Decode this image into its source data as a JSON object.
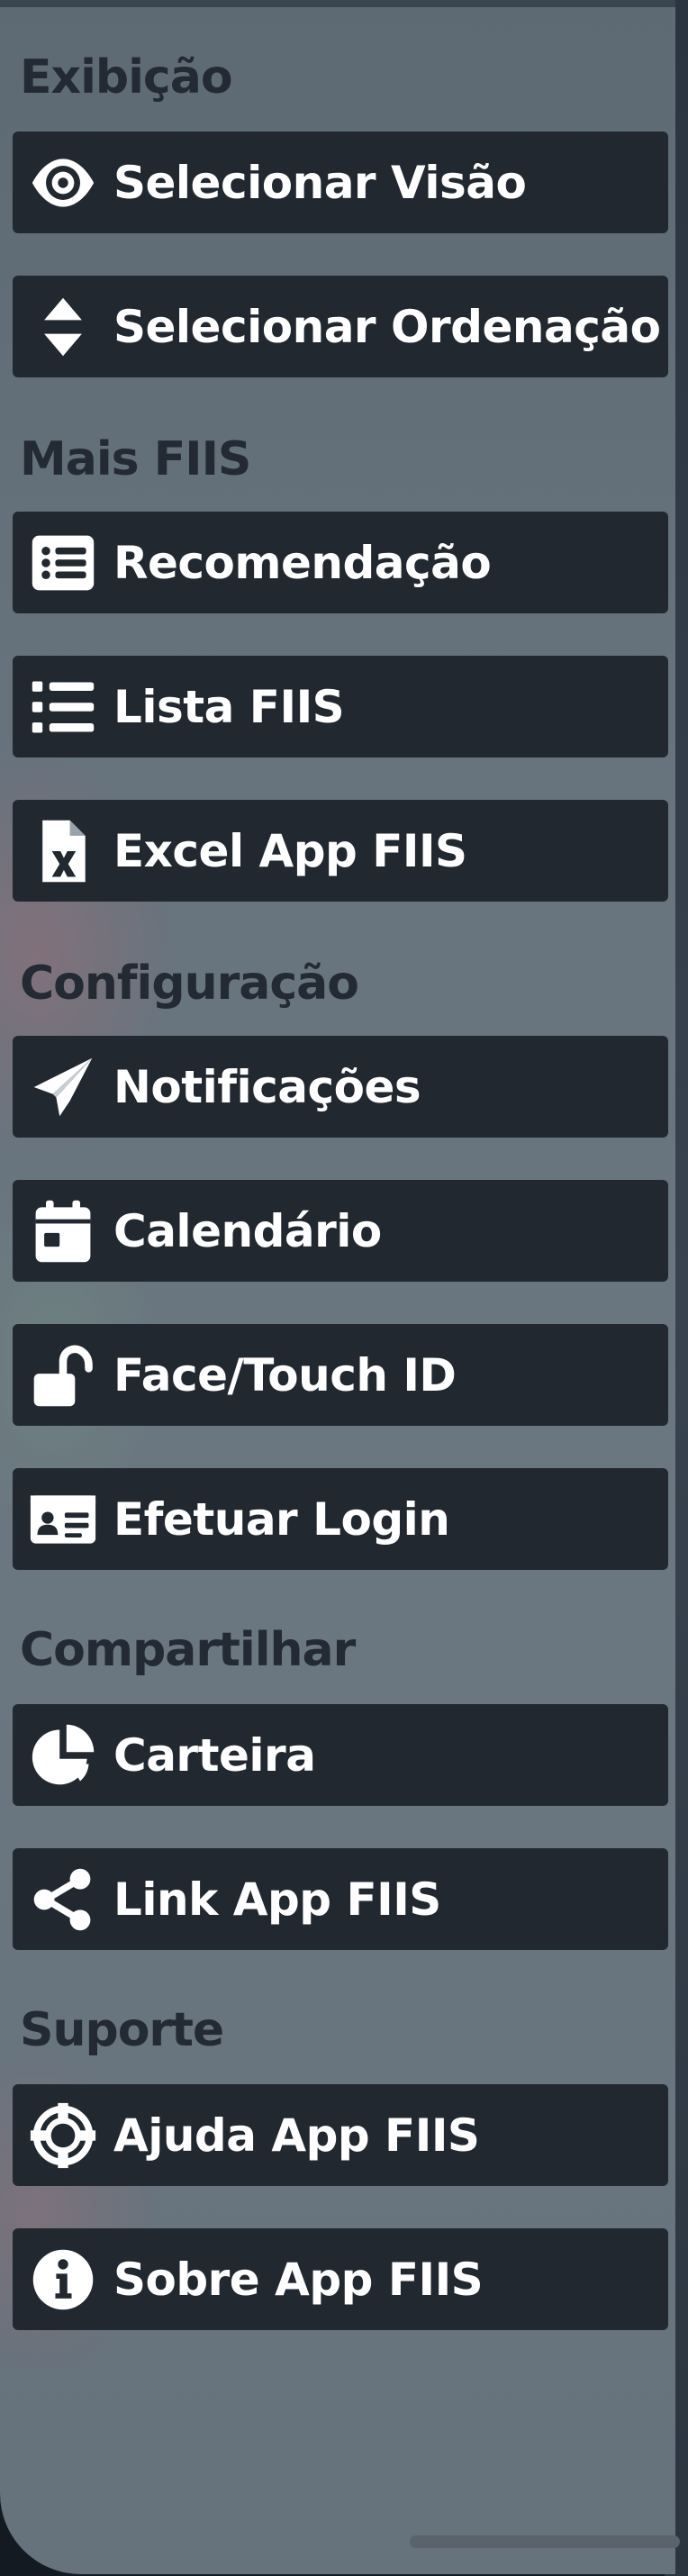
{
  "sections": [
    {
      "title": "Exibição"
    },
    {
      "title": "Mais FIIS"
    },
    {
      "title": "Configuração"
    },
    {
      "title": "Compartilhar"
    },
    {
      "title": "Suporte"
    }
  ],
  "items": [
    {
      "label": "Selecionar Visão",
      "icon": "eye-icon"
    },
    {
      "label": "Selecionar Ordenação",
      "icon": "sort-icon"
    },
    {
      "label": "Recomendação",
      "icon": "list-card-icon"
    },
    {
      "label": "Lista FIIS",
      "icon": "list-icon"
    },
    {
      "label": "Excel App FIIS",
      "icon": "excel-file-icon"
    },
    {
      "label": "Notificações",
      "icon": "paper-plane-icon"
    },
    {
      "label": "Calendário",
      "icon": "calendar-icon"
    },
    {
      "label": "Face/Touch ID",
      "icon": "unlock-icon"
    },
    {
      "label": "Efetuar Login",
      "icon": "id-card-icon"
    },
    {
      "label": "Carteira",
      "icon": "pie-chart-icon"
    },
    {
      "label": "Link App FIIS",
      "icon": "share-icon"
    },
    {
      "label": "Ajuda App FIIS",
      "icon": "life-ring-icon"
    },
    {
      "label": "Sobre App FIIS",
      "icon": "info-icon"
    }
  ],
  "colors": {
    "panel": "#66727c",
    "button": "#222830",
    "button_text": "#ffffff",
    "header_text": "#232a33"
  }
}
